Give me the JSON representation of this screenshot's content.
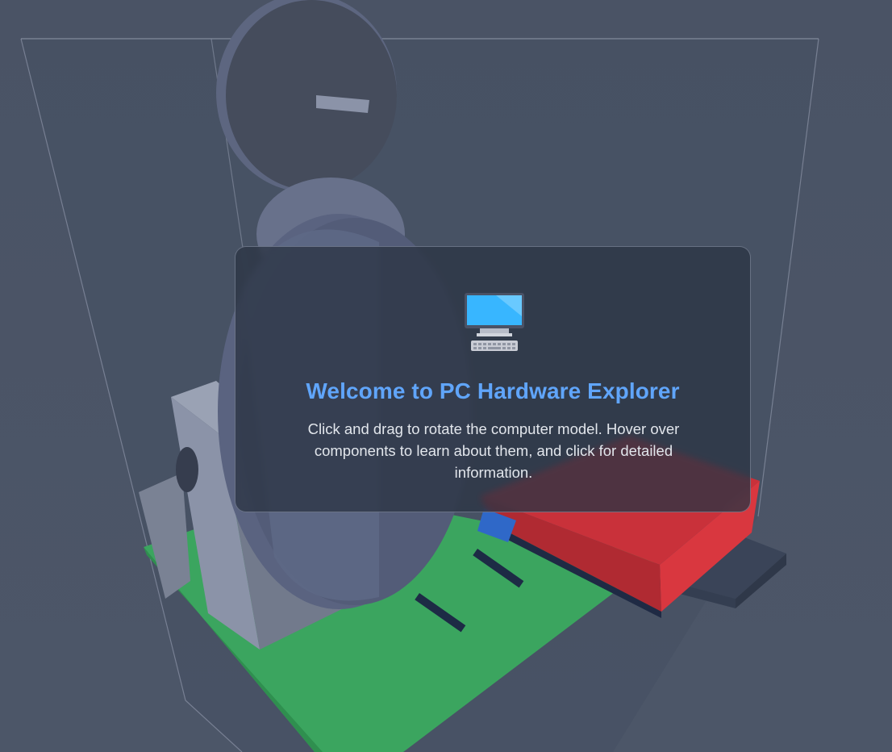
{
  "welcome": {
    "icon": "desktop-computer-icon",
    "title": "Welcome to PC Hardware Explorer",
    "text": "Click and drag to rotate the computer model. Hover over components to learn about them, and click for detailed information."
  },
  "scene": {
    "objects": [
      "case-wireframe",
      "cpu-cooler-fan",
      "gpu-card",
      "motherboard",
      "ram-stick",
      "storage-drive",
      "power-supply"
    ],
    "colors": {
      "background": "#4b5567",
      "motherboard": "#3ba55f",
      "gpu": "#d9373f",
      "fan": "#525b74",
      "ram": "#7c8498",
      "storage": "#3a4458",
      "accent": "#60a5fa"
    }
  }
}
